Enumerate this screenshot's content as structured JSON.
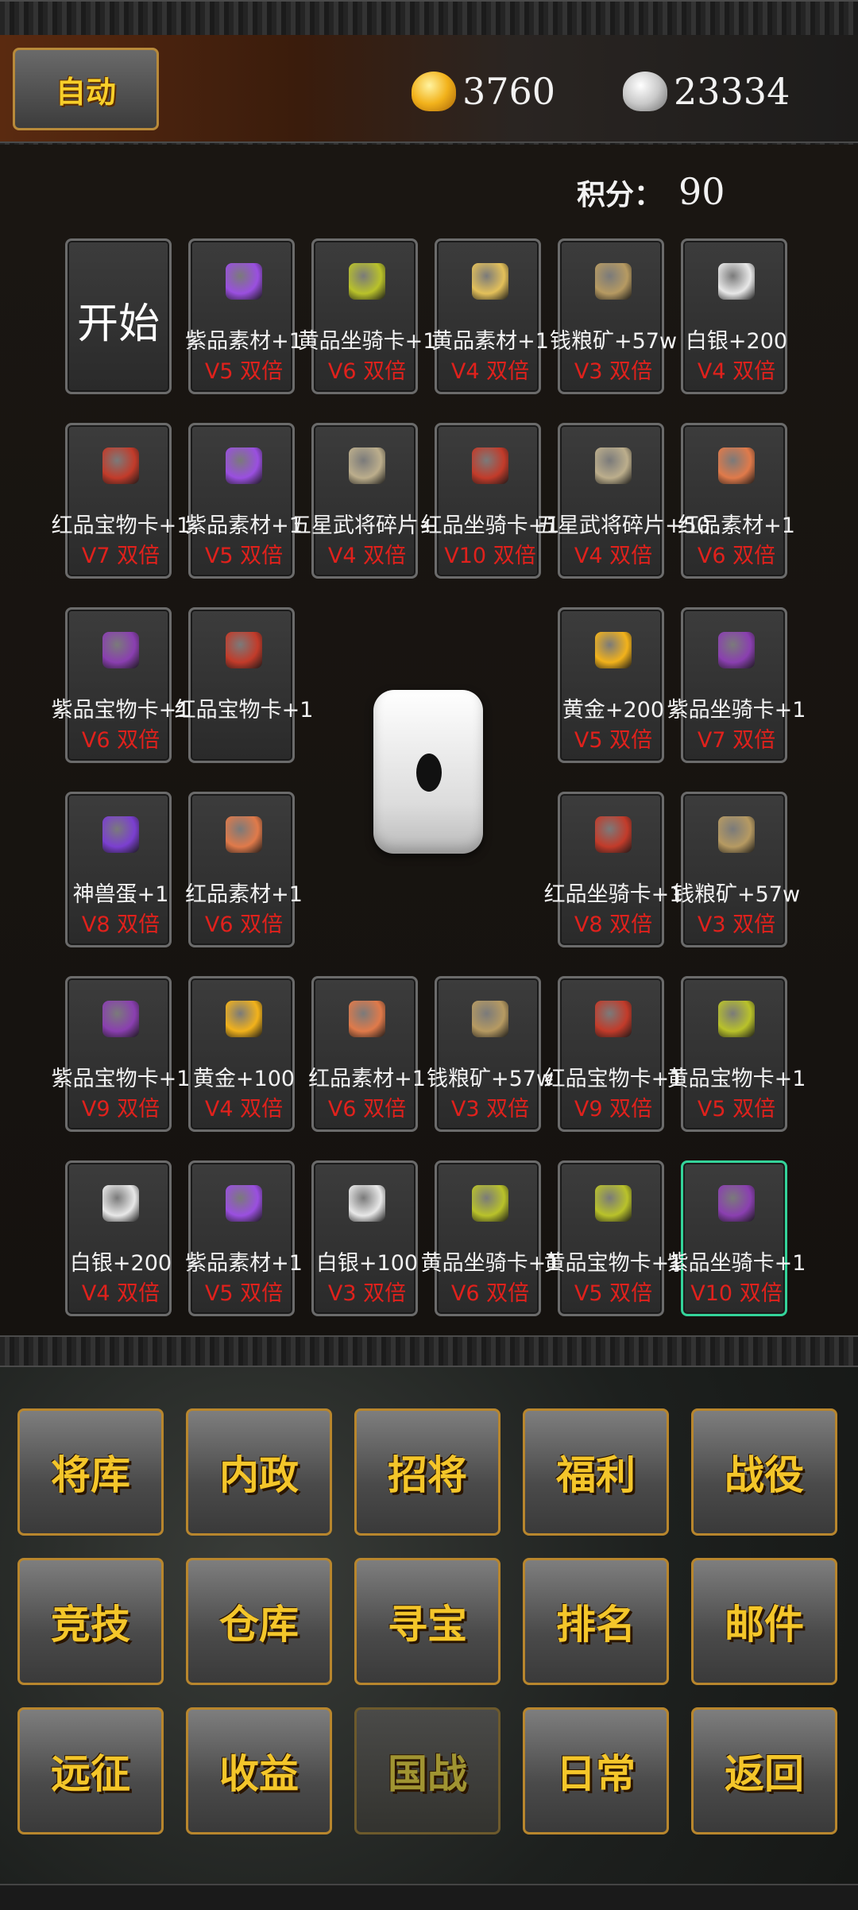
{
  "header": {
    "auto_label": "自动",
    "gold": "3760",
    "silver": "23334",
    "score_label": "积分：",
    "score_value": "90"
  },
  "board": {
    "start_label": "开始",
    "cells": [
      {
        "name": "紫品素材+1",
        "mult": "V5 双倍",
        "icon": "purple-material-icon",
        "color": "#9a4fe0"
      },
      {
        "name": "黄品坐骑卡+1",
        "mult": "V6 双倍",
        "icon": "yellow-mount-card-icon",
        "color": "#b9c22a"
      },
      {
        "name": "黄品素材+1",
        "mult": "V4 双倍",
        "icon": "yellow-material-icon",
        "color": "#e3c05a"
      },
      {
        "name": "钱粮矿+57w",
        "mult": "V3 双倍",
        "icon": "grain-ore-icon",
        "color": "#b69a62"
      },
      {
        "name": "白银+200",
        "mult": "V4 双倍",
        "icon": "silver-ingot-icon",
        "color": "#e8e8e8"
      },
      {
        "name": "红品素材+1",
        "mult": "V6 双倍",
        "icon": "red-material-icon",
        "color": "#e07a4a"
      },
      {
        "name": "五星武将碎片+50",
        "mult": "V4 双倍",
        "icon": "general-fragment-icon",
        "color": "#bcae8c"
      },
      {
        "name": "红品坐骑卡+1",
        "mult": "V10 双倍",
        "icon": "red-mount-card-icon",
        "color": "#c23b2a"
      },
      {
        "name": "五星武将碎片+50",
        "mult": "V4 双倍",
        "icon": "general-fragment-icon",
        "color": "#bcae8c"
      },
      {
        "name": "红品宝物卡+1",
        "mult": "V7 双倍",
        "icon": "red-treasure-card-icon",
        "color": "#c23b2a"
      },
      {
        "name": "紫品素材+1",
        "mult": "V5 双倍",
        "icon": "purple-material-icon",
        "color": "#9a4fe0"
      },
      {
        "name": "红品宝物卡+1",
        "mult": "",
        "icon": "red-treasure-card-icon",
        "color": "#c23b2a"
      },
      {
        "name": "紫品宝物卡+1",
        "mult": "V6 双倍",
        "icon": "purple-treasure-card-icon",
        "color": "#8a3fb0"
      },
      {
        "name": "黄金+200",
        "mult": "V5 双倍",
        "icon": "gold-ingot-icon",
        "color": "#f2b21b"
      },
      {
        "name": "紫品坐骑卡+1",
        "mult": "V7 双倍",
        "icon": "purple-mount-card-icon",
        "color": "#8a3fb0"
      },
      {
        "name": "神兽蛋+1",
        "mult": "V8 双倍",
        "icon": "beast-egg-icon",
        "color": "#7b3fd0"
      },
      {
        "name": "红品素材+1",
        "mult": "V6 双倍",
        "icon": "red-material-icon",
        "color": "#e07a4a"
      },
      {
        "name": "红品坐骑卡+1",
        "mult": "V8 双倍",
        "icon": "red-mount-card-icon",
        "color": "#c23b2a"
      },
      {
        "name": "钱粮矿+57w",
        "mult": "V3 双倍",
        "icon": "grain-ore-icon",
        "color": "#b69a62"
      },
      {
        "name": "紫品宝物卡+1",
        "mult": "V9 双倍",
        "icon": "purple-treasure-card-icon",
        "color": "#8a3fb0"
      },
      {
        "name": "黄金+100",
        "mult": "V4 双倍",
        "icon": "gold-ingot-icon",
        "color": "#f2b21b"
      },
      {
        "name": "红品素材+1",
        "mult": "V6 双倍",
        "icon": "red-material-icon",
        "color": "#e07a4a"
      },
      {
        "name": "钱粮矿+57w",
        "mult": "V3 双倍",
        "icon": "grain-ore-icon",
        "color": "#b69a62"
      },
      {
        "name": "红品宝物卡+1",
        "mult": "V9 双倍",
        "icon": "red-treasure-card-icon",
        "color": "#c23b2a"
      },
      {
        "name": "黄品宝物卡+1",
        "mult": "V5 双倍",
        "icon": "yellow-treasure-card-icon",
        "color": "#b9c22a"
      },
      {
        "name": "白银+200",
        "mult": "V4 双倍",
        "icon": "silver-ingot-icon",
        "color": "#e8e8e8"
      },
      {
        "name": "紫品素材+1",
        "mult": "V5 双倍",
        "icon": "purple-material-icon",
        "color": "#9a4fe0"
      },
      {
        "name": "白银+100",
        "mult": "V3 双倍",
        "icon": "silver-ingot-icon",
        "color": "#e8e8e8"
      },
      {
        "name": "黄品坐骑卡+1",
        "mult": "V6 双倍",
        "icon": "yellow-mount-card-icon",
        "color": "#b9c22a"
      },
      {
        "name": "黄品宝物卡+1",
        "mult": "V5 双倍",
        "icon": "yellow-treasure-card-icon",
        "color": "#b9c22a"
      },
      {
        "name": "紫品坐骑卡+1",
        "mult": "V10 双倍",
        "icon": "purple-mount-card-icon",
        "color": "#8a3fb0"
      }
    ]
  },
  "menu": {
    "buttons": [
      "将库",
      "内政",
      "招将",
      "福利",
      "战役",
      "竞技",
      "仓库",
      "寻宝",
      "排名",
      "邮件",
      "远征",
      "收益",
      "国战",
      "日常",
      "返回"
    ]
  }
}
